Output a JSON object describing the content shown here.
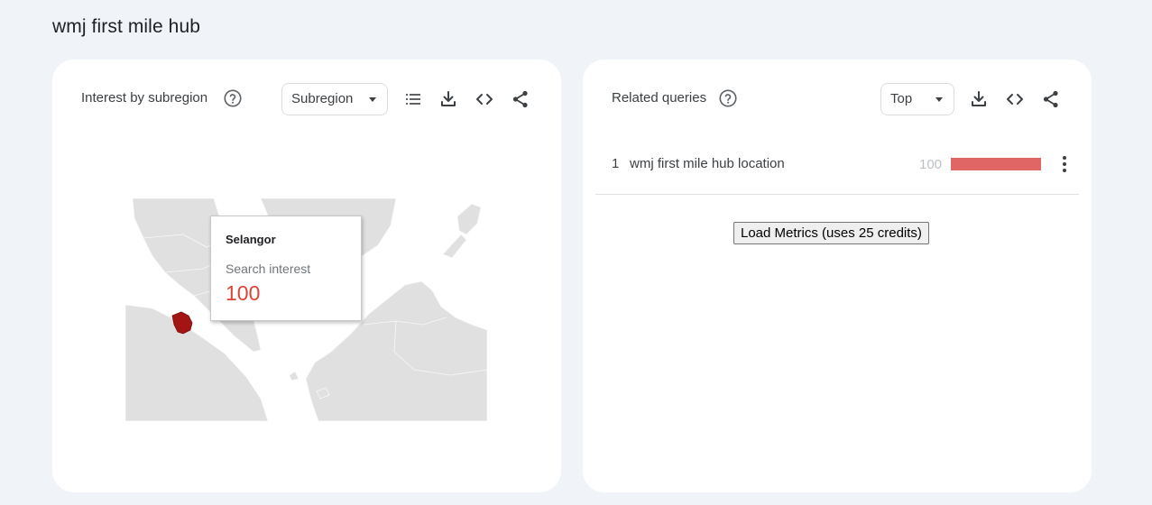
{
  "page": {
    "title": "wmj first mile hub"
  },
  "subregion_card": {
    "title": "Interest by subregion",
    "select_label": "Subregion",
    "tooltip": {
      "region": "Selangor",
      "metric_label": "Search interest",
      "value": "100"
    },
    "icons": [
      "help-icon",
      "list-icon",
      "download-icon",
      "embed-code-icon",
      "share-icon"
    ]
  },
  "queries_card": {
    "title": "Related queries",
    "select_label": "Top",
    "rows": [
      {
        "rank": "1",
        "query": "wmj first mile hub location",
        "value": "100",
        "bar_fraction": 1.0
      }
    ],
    "load_button": "Load Metrics (uses 25 credits)",
    "icons": [
      "help-icon",
      "download-icon",
      "embed-code-icon",
      "share-icon",
      "more-vert-icon"
    ]
  },
  "colors": {
    "background": "#f0f4f9",
    "card": "#ffffff",
    "accent_red": "#db4437",
    "bar_red": "#e06666",
    "highlight_region": "#a31515",
    "map_land": "#e0e0e0"
  }
}
